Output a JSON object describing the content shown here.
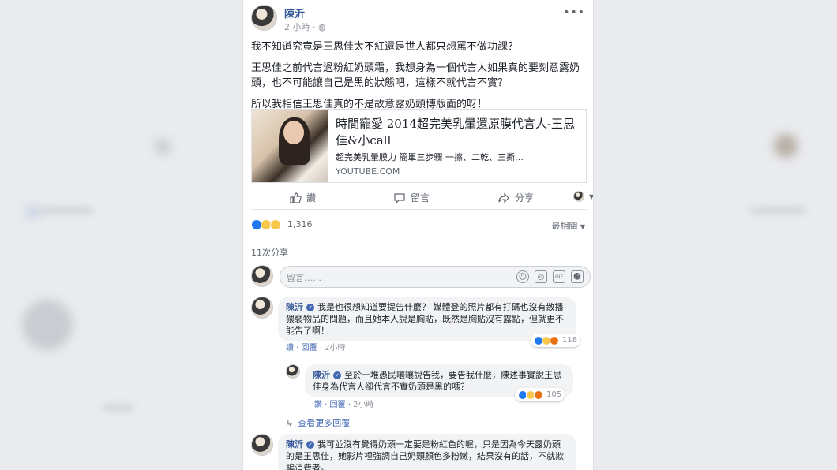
{
  "post": {
    "author": "陳沂",
    "time": "2 小時",
    "more_label": "•••",
    "paragraphs": [
      "我不知道究竟是王思佳太不紅還是世人都只想罵不做功課？",
      "王思佳之前代言過粉紅奶頭霜，我想身為一個代言人如果真的要刻意露奶頭，也不可能讓自己是黑的狀態吧，這樣不就代言不實？",
      "所以我相信王思佳真的不是故意露奶頭博版面的呀！"
    ],
    "link": {
      "title": "時間寵愛 2014超完美乳暈還原膜代言人-王思佳&小call",
      "description": "超完美乳暈膜力 簡單三步驟 一擦、二乾、三撕…",
      "domain": "YOUTUBE.COM"
    },
    "actions": {
      "like": "讚",
      "comment": "留言",
      "share": "分享"
    },
    "reactions_count": "1,316",
    "sort_label": "最相關",
    "shares_label": "11次分享",
    "comment_placeholder": "留言……"
  },
  "comments": [
    {
      "author": "陳沂",
      "text": "我是也很想知道要提告什麼？ 媒體登的照片都有打碼也沒有散播猥褻物品的問題，而且她本人說是胸貼，既然是胸貼沒有露點，但就更不能告了啊！",
      "like": "讚",
      "reply": "回覆",
      "time": "2小時",
      "reaction_count": "118"
    },
    {
      "author": "陳沂",
      "text": "至於一堆愚民嚷嚷說告我，要告我什麼，陳述事實說王思佳身為代言人卻代言不實奶頭是黑的嗎？",
      "like": "讚",
      "reply": "回覆",
      "time": "2小時",
      "reaction_count": "105"
    },
    {
      "author": "陳沂",
      "text": "我可並沒有覺得奶頭一定要是粉紅色的喔，只是因為今天露奶頭的是王思佳，她影片裡強調自己奶頭顏色多粉嫩，結果沒有的話，不就欺騙消費者。"
    }
  ],
  "more_replies_label": "查看更多回覆",
  "colors": {
    "link_blue": "#365899",
    "meta_blue": "#4267b2",
    "bubble_bg": "#f2f3f5",
    "page_bg": "#e9ebee"
  }
}
